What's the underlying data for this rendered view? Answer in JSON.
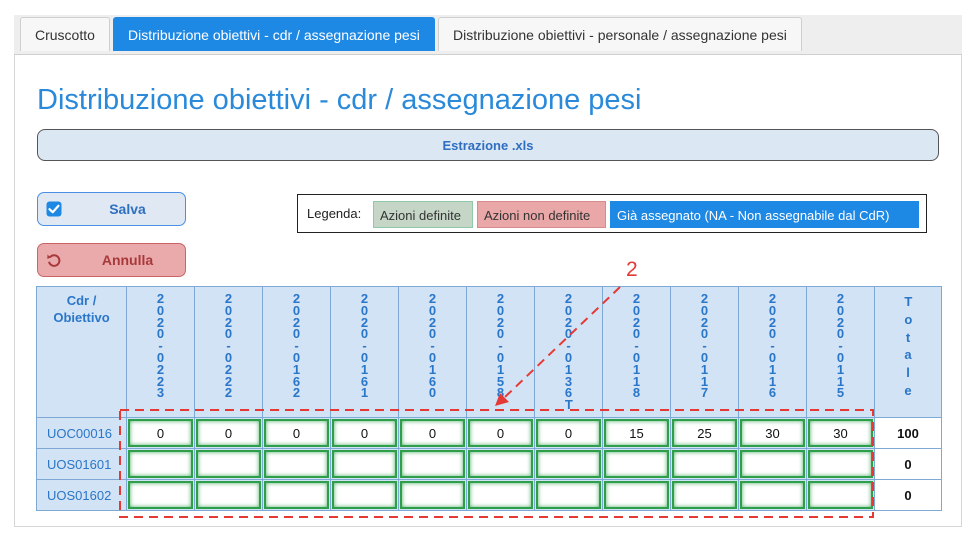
{
  "tabs": [
    {
      "label": "Cruscotto",
      "active": false
    },
    {
      "label": "Distribuzione obiettivi - cdr / assegnazione pesi",
      "active": true
    },
    {
      "label": "Distribuzione obiettivi - personale / assegnazione pesi",
      "active": false
    }
  ],
  "page_title": "Distribuzione obiettivi - cdr / assegnazione pesi",
  "export_label": "Estrazione .xls",
  "actions": {
    "save_label": "Salva",
    "save_icon": "checkbox-checked-icon",
    "cancel_label": "Annulla",
    "cancel_icon": "undo-icon"
  },
  "legend": {
    "label": "Legenda:",
    "defined": "Azioni definite",
    "undefined": "Azioni non definite",
    "assigned": "Già assegnato (NA - Non assegnabile dal CdR)"
  },
  "grid": {
    "corner_label": "Cdr / Obiettivo",
    "objectives": [
      "2020-0223",
      "2020-0222",
      "2020-0162",
      "2020-0161",
      "2020-0160",
      "2020-0158",
      "2020-0136T",
      "2020-0118",
      "2020-0117",
      "2020-0116",
      "2020-0115"
    ],
    "total_label": "Totale",
    "rows": [
      {
        "cdr": "UOC00016",
        "values": [
          "0",
          "0",
          "0",
          "0",
          "0",
          "0",
          "0",
          "15",
          "25",
          "30",
          "30"
        ],
        "total": "100"
      },
      {
        "cdr": "UOS01601",
        "values": [
          "",
          "",
          "",
          "",
          "",
          "",
          "",
          "",
          "",
          "",
          ""
        ],
        "total": "0"
      },
      {
        "cdr": "UOS01602",
        "values": [
          "",
          "",
          "",
          "",
          "",
          "",
          "",
          "",
          "",
          "",
          ""
        ],
        "total": "0"
      }
    ]
  },
  "annotation": {
    "number": "2",
    "color": "#e53935"
  }
}
